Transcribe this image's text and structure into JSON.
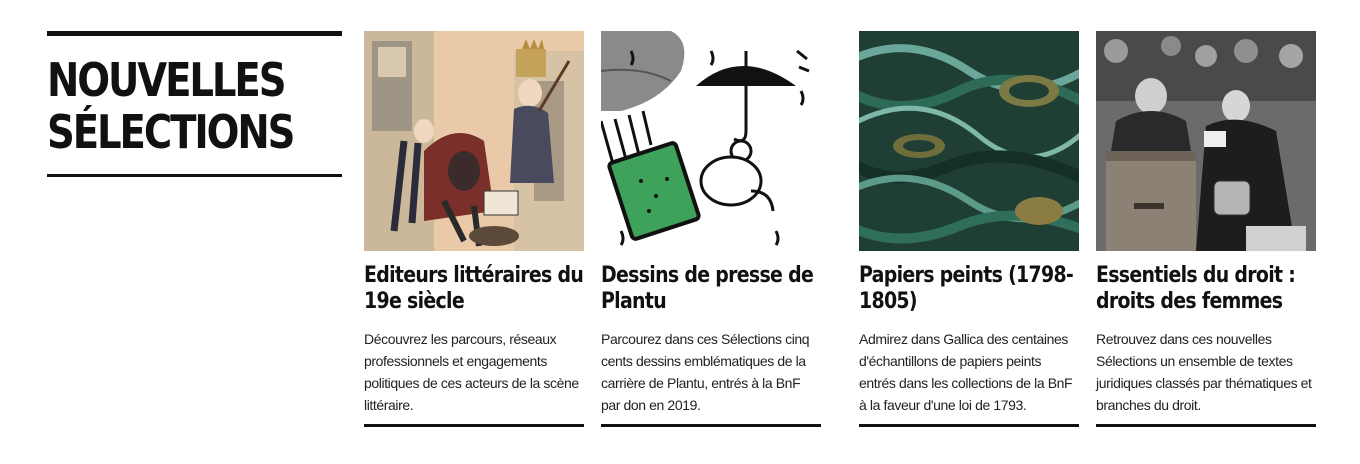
{
  "section": {
    "title": "NOUVELLES\nSÉLECTIONS"
  },
  "cards": [
    {
      "title": "Editeurs littéraires du 19e siècle",
      "description": "Découvrez les parcours, réseaux professionnels et engagements politiques de ces acteurs de la scène littéraire.",
      "image_icon": "caricature-illustration"
    },
    {
      "title": "Dessins de presse de Plantu",
      "description": "Parcourez dans ces Sélections cinq cents dessins emblématiques de la carrière de Plantu, entrés à la BnF par don en 2019.",
      "image_icon": "umbrella-cartoon-illustration"
    },
    {
      "title": "Papiers peints (1798-1805)",
      "description": "Admirez dans Gallica des centaines d'échantillons de papiers peints entrés dans les collections de la BnF à la faveur d'une loi de 1793.",
      "image_icon": "marbled-pattern-illustration"
    },
    {
      "title": "Essentiels du droit : droits des femmes",
      "description": "Retrouvez dans ces nouvelles Sélections un ensemble de textes juridiques classés par thématiques et branches du droit.",
      "image_icon": "ballot-box-photo"
    }
  ]
}
